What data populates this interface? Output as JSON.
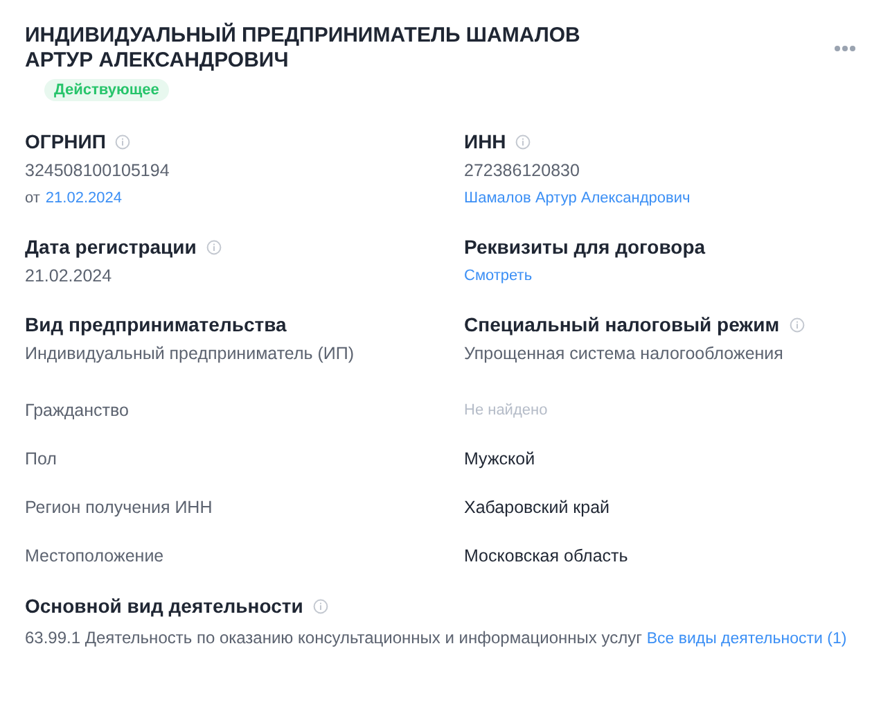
{
  "title": "ИНДИВИДУАЛЬНЫЙ ПРЕДПРИНИМАТЕЛЬ ШАМАЛОВ АРТУР АЛЕКСАНДРОВИЧ",
  "status": {
    "label": "Действующее",
    "kind": "active"
  },
  "sections": [
    {
      "label": "ОГРНИП",
      "info": true,
      "lines": [
        [
          {
            "text": "324508100105194",
            "kind": "plain"
          }
        ],
        [
          {
            "text": "от",
            "kind": "small"
          },
          {
            "text": "21.02.2024",
            "kind": "link"
          }
        ]
      ]
    },
    {
      "label": "ИНН",
      "info": true,
      "lines": [
        [
          {
            "text": "272386120830",
            "kind": "plain"
          }
        ],
        [
          {
            "text": "Шамалов Артур Александрович",
            "kind": "link"
          }
        ]
      ]
    },
    {
      "label": "Дата регистрации",
      "info": true,
      "lines": [
        [
          {
            "text": "21.02.2024",
            "kind": "plain"
          }
        ]
      ]
    },
    {
      "label": "Реквизиты для договора",
      "info": false,
      "lines": [
        [
          {
            "text": "Смотреть",
            "kind": "link"
          }
        ]
      ]
    },
    {
      "label": "Вид предпринимательства",
      "info": false,
      "lines": [
        [
          {
            "text": "Индивидуальный предприниматель (ИП)",
            "kind": "plain"
          }
        ]
      ]
    },
    {
      "label": "Специальный налоговый режим",
      "info": true,
      "lines": [
        [
          {
            "text": "Упрощенная система налогообложения",
            "kind": "plain"
          }
        ]
      ]
    }
  ],
  "facts": [
    {
      "label": "Гражданство",
      "value": "Не найдено",
      "kind": "missing"
    },
    {
      "label": "Пол",
      "value": "Мужской",
      "kind": "plain"
    },
    {
      "label": "Регион получения ИНН",
      "value": "Хабаровский край",
      "kind": "plain"
    },
    {
      "label": "Местоположение",
      "value": "Московская область",
      "kind": "plain"
    }
  ],
  "activity": {
    "label": "Основной вид деятельности",
    "info": true,
    "text": "63.99.1 Деятельность по оказанию консультационных и информационных услуг",
    "link": "Все виды деятельности (1)"
  }
}
